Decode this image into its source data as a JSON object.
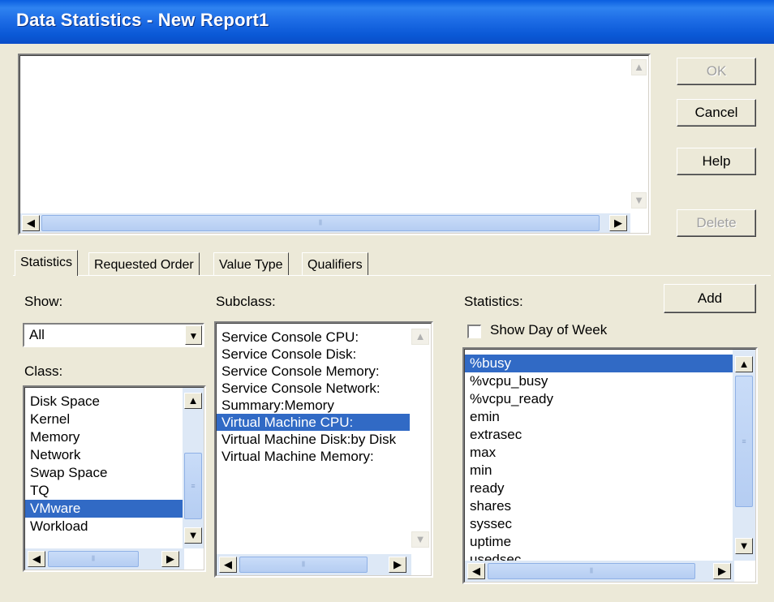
{
  "window": {
    "title": "Data Statistics - New Report1"
  },
  "buttons": {
    "ok": "OK",
    "cancel": "Cancel",
    "help": "Help",
    "delete": "Delete",
    "add": "Add"
  },
  "tabs": [
    {
      "label": "Statistics",
      "active": true
    },
    {
      "label": "Requested Order",
      "active": false
    },
    {
      "label": "Value Type",
      "active": false
    },
    {
      "label": "Qualifiers",
      "active": false
    }
  ],
  "show": {
    "label": "Show:",
    "value": "All"
  },
  "class": {
    "label": "Class:",
    "items": [
      "Disk Space",
      "Kernel",
      "Memory",
      "Network",
      "Swap Space",
      "TQ",
      "VMware",
      "Workload"
    ],
    "selected": 6
  },
  "subclass": {
    "label": "Subclass:",
    "items": [
      "Service Console CPU:",
      "Service Console Disk:",
      "Service Console Memory:",
      "Service Console Network:",
      "Summary:Memory",
      "Virtual Machine CPU:",
      "Virtual Machine Disk:by Disk",
      "Virtual Machine Memory:"
    ],
    "selected": 5
  },
  "statistics": {
    "label": "Statistics:",
    "show_day_of_week": "Show Day of Week",
    "items": [
      "%busy",
      "%vcpu_busy",
      "%vcpu_ready",
      "emin",
      "extrasec",
      "max",
      "min",
      "ready",
      "shares",
      "syssec",
      "uptime",
      "usedsec"
    ],
    "selected": 0
  },
  "icons": {
    "scroll_left": "◀",
    "scroll_right": "▶",
    "scroll_up": "▲",
    "scroll_down": "▼",
    "dropdown": "▼",
    "grip_h": "⦀",
    "grip_v": "≡"
  },
  "colors": {
    "selection": "#316ac5",
    "title_bar": "#0a5fe0",
    "face": "#ece9d8"
  }
}
